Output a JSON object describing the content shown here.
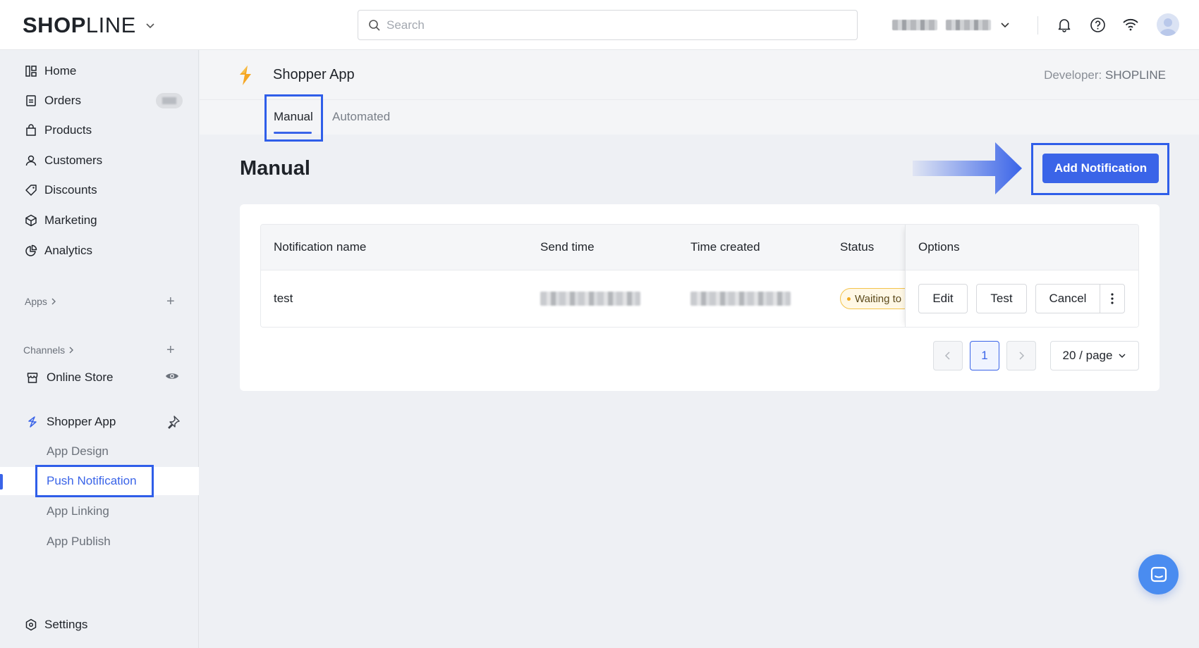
{
  "topbar": {
    "logo_part1": "SHO",
    "logo_part2": "P",
    "logo_part3": "LINE",
    "search_placeholder": "Search",
    "icons": [
      "chevron-down-icon",
      "search-icon",
      "bell-icon",
      "help-icon",
      "wifi-icon",
      "avatar"
    ]
  },
  "sidebar": {
    "items": [
      {
        "label": "Home",
        "icon": "home-icon"
      },
      {
        "label": "Orders",
        "icon": "orders-icon"
      },
      {
        "label": "Products",
        "icon": "bag-icon"
      },
      {
        "label": "Customers",
        "icon": "user-icon"
      },
      {
        "label": "Discounts",
        "icon": "tag-icon"
      },
      {
        "label": "Marketing",
        "icon": "cube-icon"
      },
      {
        "label": "Analytics",
        "icon": "pie-chart-icon"
      }
    ],
    "apps_label": "Apps",
    "channels_label": "Channels",
    "online_store": "Online Store",
    "shopper_app": "Shopper App",
    "sub_items": [
      "App Design",
      "Push Notification",
      "App Linking",
      "App Publish"
    ],
    "active_sub": "Push Notification",
    "settings": "Settings"
  },
  "app_header": {
    "title": "Shopper App",
    "developer_label": "Developer:",
    "developer_value": "SHOPLINE"
  },
  "tabs": [
    {
      "label": "Manual",
      "active": true
    },
    {
      "label": "Automated",
      "active": false
    }
  ],
  "page": {
    "title": "Manual",
    "add_button": "Add Notification"
  },
  "table": {
    "columns": [
      "Notification name",
      "Send time",
      "Time created",
      "Status",
      "Options"
    ],
    "rows": [
      {
        "name": "test",
        "status": "Waiting to",
        "actions": [
          "Edit",
          "Test",
          "Cancel"
        ]
      }
    ]
  },
  "pagination": {
    "current_page": "1",
    "page_size": "20 / page"
  },
  "colors": {
    "accent": "#3a64e8",
    "highlight": "#2f5ee9",
    "status_warning": "#f3c34a"
  }
}
